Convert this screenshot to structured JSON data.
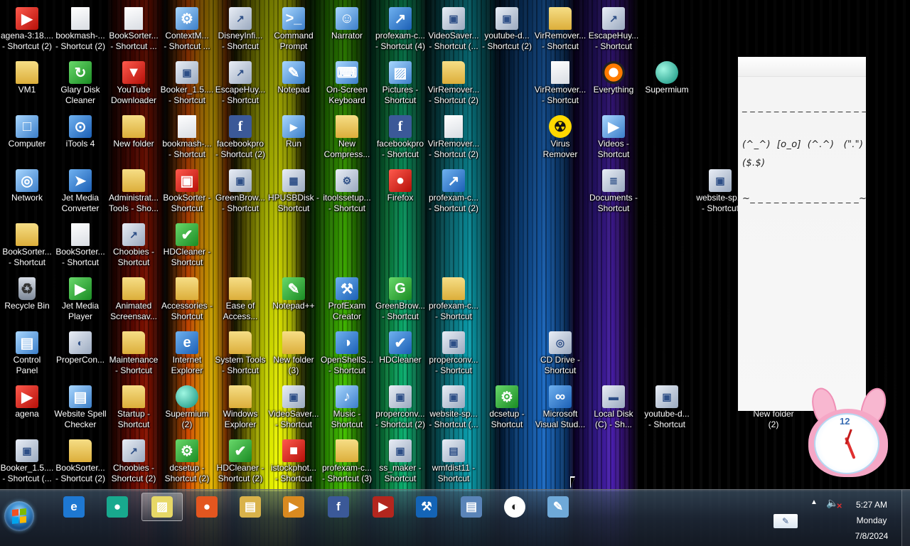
{
  "desktop": {
    "icons": [
      {
        "label": "agena-3:18....\n- Shortcut (2)",
        "glyph": "▶",
        "type": "red"
      },
      {
        "label": "bookmash-...\n- Shortcut (2)",
        "glyph": "",
        "type": "file"
      },
      {
        "label": "BookSorter...\n- Shortcut ...",
        "glyph": "",
        "type": "file"
      },
      {
        "label": "ContextM...\n- Shortcut ...",
        "glyph": "⚙",
        "type": "sys"
      },
      {
        "label": "DisneyInfi...\n- Shortcut",
        "glyph": "↗",
        "type": "shortcut"
      },
      {
        "label": "Command\nPrompt",
        "glyph": ">_",
        "type": "sys"
      },
      {
        "label": "Narrator",
        "glyph": "☺",
        "type": "sys"
      },
      {
        "label": "profexam-c...\n- Shortcut (4)",
        "glyph": "↗",
        "type": "app"
      },
      {
        "label": "VideoSaver...\n- Shortcut (...",
        "glyph": "▣",
        "type": "shortcut"
      },
      {
        "label": "youtube-d...\n- Shortcut (2)",
        "glyph": "▣",
        "type": "shortcut"
      },
      {
        "label": "VirRemover...\n- Shortcut",
        "glyph": "",
        "type": "folder"
      },
      {
        "label": "EscapeHuy...\n- Shortcut",
        "glyph": "↗",
        "type": "shortcut"
      },
      {
        "label": "VM1",
        "glyph": "",
        "type": "folder"
      },
      {
        "label": "Glary Disk\nCleaner",
        "glyph": "↻",
        "type": "green"
      },
      {
        "label": "YouTube\nDownloader",
        "glyph": "▼",
        "type": "red"
      },
      {
        "label": "Booker_1.5....\n- Shortcut",
        "glyph": "▣",
        "type": "shortcut"
      },
      {
        "label": "EscapeHuy...\n- Shortcut",
        "glyph": "↗",
        "type": "shortcut"
      },
      {
        "label": "Notepad",
        "glyph": "✎",
        "type": "sys"
      },
      {
        "label": "On-Screen\nKeyboard",
        "glyph": "⌨",
        "type": "sys"
      },
      {
        "label": "Pictures -\nShortcut",
        "glyph": "▨",
        "type": "sys"
      },
      {
        "label": "VirRemover...\n- Shortcut (2)",
        "glyph": "",
        "type": "folder"
      },
      {
        "label": "VirRemover...\n- Shortcut",
        "glyph": "",
        "type": "file"
      },
      {
        "label": "Everything",
        "glyph": "",
        "type": "orange"
      },
      {
        "label": "Supermium",
        "glyph": "",
        "type": "teal"
      },
      {
        "label": "Computer",
        "glyph": "□",
        "type": "sys"
      },
      {
        "label": "iTools 4",
        "glyph": "⊙",
        "type": "app"
      },
      {
        "label": "New folder",
        "glyph": "",
        "type": "folder"
      },
      {
        "label": "bookmash-...\n- Shortcut",
        "glyph": "",
        "type": "file"
      },
      {
        "label": "facebookpro\n- Shortcut (2)",
        "glyph": "f",
        "type": "fb"
      },
      {
        "label": "Run",
        "glyph": "▸",
        "type": "sys"
      },
      {
        "label": "New\nCompress...",
        "glyph": "",
        "type": "folder"
      },
      {
        "label": "facebookpro\n- Shortcut",
        "glyph": "f",
        "type": "fb"
      },
      {
        "label": "VirRemover...\n- Shortcut (2)",
        "glyph": "",
        "type": "file"
      },
      {
        "label": "Virus\nRemover",
        "glyph": "☢",
        "type": "warn"
      },
      {
        "label": "Videos -\nShortcut",
        "glyph": "▶",
        "type": "sys"
      },
      {
        "label": "Network",
        "glyph": "◎",
        "type": "sys"
      },
      {
        "label": "Jet Media\nConverter",
        "glyph": "➤",
        "type": "app"
      },
      {
        "label": "Administrat...\nTools - Sho...",
        "glyph": "",
        "type": "folder"
      },
      {
        "label": "BookSorter -\nShortcut",
        "glyph": "▣",
        "type": "red"
      },
      {
        "label": "GreenBrow...\n- Shortcut",
        "glyph": "▣",
        "type": "shortcut"
      },
      {
        "label": "HPUSBDisk -\nShortcut",
        "glyph": "▦",
        "type": "shortcut"
      },
      {
        "label": "itoolssetup...\n- Shortcut",
        "glyph": "⚙",
        "type": "shortcut"
      },
      {
        "label": "Firefox",
        "glyph": "●",
        "type": "red"
      },
      {
        "label": "profexam-c...\n- Shortcut (2)",
        "glyph": "↗",
        "type": "app"
      },
      {
        "label": "Documents -\nShortcut",
        "glyph": "≣",
        "type": "shortcut"
      },
      {
        "label": "website-sp...\n- Shortcut",
        "glyph": "▣",
        "type": "shortcut"
      },
      {
        "label": "BookSorter...\n- Shortcut",
        "glyph": "",
        "type": "folder"
      },
      {
        "label": "BookSorter...\n- Shortcut",
        "glyph": "",
        "type": "file"
      },
      {
        "label": "Choobies -\nShortcut",
        "glyph": "↗",
        "type": "shortcut"
      },
      {
        "label": "HDCleaner -\nShortcut",
        "glyph": "✔",
        "type": "green"
      },
      {
        "label": "Recycle Bin",
        "glyph": "♻",
        "type": "bin"
      },
      {
        "label": "Jet Media\nPlayer",
        "glyph": "▶",
        "type": "green"
      },
      {
        "label": "Animated\nScreensav...",
        "glyph": "",
        "type": "folder"
      },
      {
        "label": "Accessories -\nShortcut",
        "glyph": "",
        "type": "folder"
      },
      {
        "label": "Ease of\nAccess...",
        "glyph": "",
        "type": "folder"
      },
      {
        "label": "Notepad++",
        "glyph": "✎",
        "type": "green"
      },
      {
        "label": "ProfExam\nCreator",
        "glyph": "⚒",
        "type": "app"
      },
      {
        "label": "GreenBrow...\n- Shortcut",
        "glyph": "G",
        "type": "green"
      },
      {
        "label": "profexam-c...\n- Shortcut",
        "glyph": "",
        "type": "folder"
      },
      {
        "label": "Control\nPanel",
        "glyph": "▤",
        "type": "sys"
      },
      {
        "label": "ProperCon...",
        "glyph": "◐",
        "type": "shortcut"
      },
      {
        "label": "Maintenance\n- Shortcut",
        "glyph": "",
        "type": "folder"
      },
      {
        "label": "Internet\nExplorer",
        "glyph": "e",
        "type": "app"
      },
      {
        "label": "System Tools\n- Shortcut",
        "glyph": "",
        "type": "folder"
      },
      {
        "label": "New folder\n(3)",
        "glyph": "",
        "type": "folder"
      },
      {
        "label": "OpenShellS...\n- Shortcut",
        "glyph": "◑",
        "type": "app"
      },
      {
        "label": "HDCleaner",
        "glyph": "✔",
        "type": "app"
      },
      {
        "label": "properconv...\n- Shortcut",
        "glyph": "▣",
        "type": "shortcut"
      },
      {
        "label": "CD Drive -\nShortcut",
        "glyph": "◎",
        "type": "shortcut"
      },
      {
        "label": "agena",
        "glyph": "▶",
        "type": "red"
      },
      {
        "label": "Website Spell\nChecker",
        "glyph": "▤",
        "type": "sys"
      },
      {
        "label": "Startup -\nShortcut",
        "glyph": "",
        "type": "folder"
      },
      {
        "label": "Supermium\n(2)",
        "glyph": "",
        "type": "teal"
      },
      {
        "label": "Windows\nExplorer",
        "glyph": "",
        "type": "folder"
      },
      {
        "label": "VideoSaver...\n- Shortcut",
        "glyph": "▣",
        "type": "shortcut"
      },
      {
        "label": "Music -\nShortcut",
        "glyph": "♪",
        "type": "sys"
      },
      {
        "label": "properconv...\n- Shortcut (2)",
        "glyph": "▣",
        "type": "shortcut"
      },
      {
        "label": "website-sp...\n- Shortcut (...",
        "glyph": "▣",
        "type": "shortcut"
      },
      {
        "label": "dcsetup -\nShortcut",
        "glyph": "⚙",
        "type": "green"
      },
      {
        "label": "Microsoft\nVisual Stud...",
        "glyph": "∞",
        "type": "app"
      },
      {
        "label": "Local Disk\n(C) - Sh...",
        "glyph": "▬",
        "type": "shortcut"
      },
      {
        "label": "youtube-d...\n- Shortcut",
        "glyph": "▣",
        "type": "shortcut"
      },
      {
        "label": "New folder\n(2)",
        "glyph": "",
        "type": "folder"
      },
      {
        "label": "Booker_1.5....\n- Shortcut (...",
        "glyph": "▣",
        "type": "shortcut"
      },
      {
        "label": "BookSorter...\n- Shortcut (2)",
        "glyph": "",
        "type": "folder"
      },
      {
        "label": "Choobies -\nShortcut (2)",
        "glyph": "↗",
        "type": "shortcut"
      },
      {
        "label": "dcsetup -\nShortcut (2)",
        "glyph": "⚙",
        "type": "green"
      },
      {
        "label": "HDCleaner -\nShortcut (2)",
        "glyph": "✔",
        "type": "green"
      },
      {
        "label": "istockphot...\n- Shortcut",
        "glyph": "■",
        "type": "red"
      },
      {
        "label": "profexam-c...\n- Shortcut (3)",
        "glyph": "",
        "type": "folder"
      },
      {
        "label": "ss_maker -\nShortcut",
        "glyph": "▣",
        "type": "shortcut"
      },
      {
        "label": "wmfdist11 -\nShortcut",
        "glyph": "▤",
        "type": "shortcut"
      }
    ]
  },
  "sticky_note": {
    "lines": [
      "_ _ _ _ _ _ _ _ _ _ _ _ _ _ _ _",
      "(^_^)  [o_o]  (^.^)   (\".\")",
      "($.$)",
      "~_ _ _ _ _ _ _ _ _ _ _ _ _ _~"
    ]
  },
  "clock_gadget": {
    "numeral": "12"
  },
  "taskbar": {
    "start_label": "Start",
    "buttons": [
      {
        "name": "internet-explorer",
        "glyph": "e",
        "color": "#1e78d2"
      },
      {
        "name": "supermium",
        "glyph": "●",
        "color": "#18a98e"
      },
      {
        "name": "sticky-notes",
        "glyph": "▨",
        "color": "#e7d866",
        "active": true
      },
      {
        "name": "firefox",
        "glyph": "●",
        "color": "#e3561f"
      },
      {
        "name": "windows-explorer",
        "glyph": "▤",
        "color": "#d9b24a"
      },
      {
        "name": "media-player",
        "glyph": "▶",
        "color": "#d98a20"
      },
      {
        "name": "facebookpro",
        "glyph": "f",
        "color": "#3b5998"
      },
      {
        "name": "agena",
        "glyph": "▶",
        "color": "#b3261e"
      },
      {
        "name": "profexam-creator",
        "glyph": "⚒",
        "color": "#1464b6"
      },
      {
        "name": "website-spell-checker",
        "glyph": "▤",
        "color": "#5a84b8"
      },
      {
        "name": "properconvert",
        "glyph": "◐",
        "color": "#ffffff"
      },
      {
        "name": "notepad",
        "glyph": "✎",
        "color": "#6fa9d8"
      }
    ],
    "clock": {
      "time": "5:27 AM",
      "day": "Monday",
      "date": "7/8/2024"
    }
  }
}
